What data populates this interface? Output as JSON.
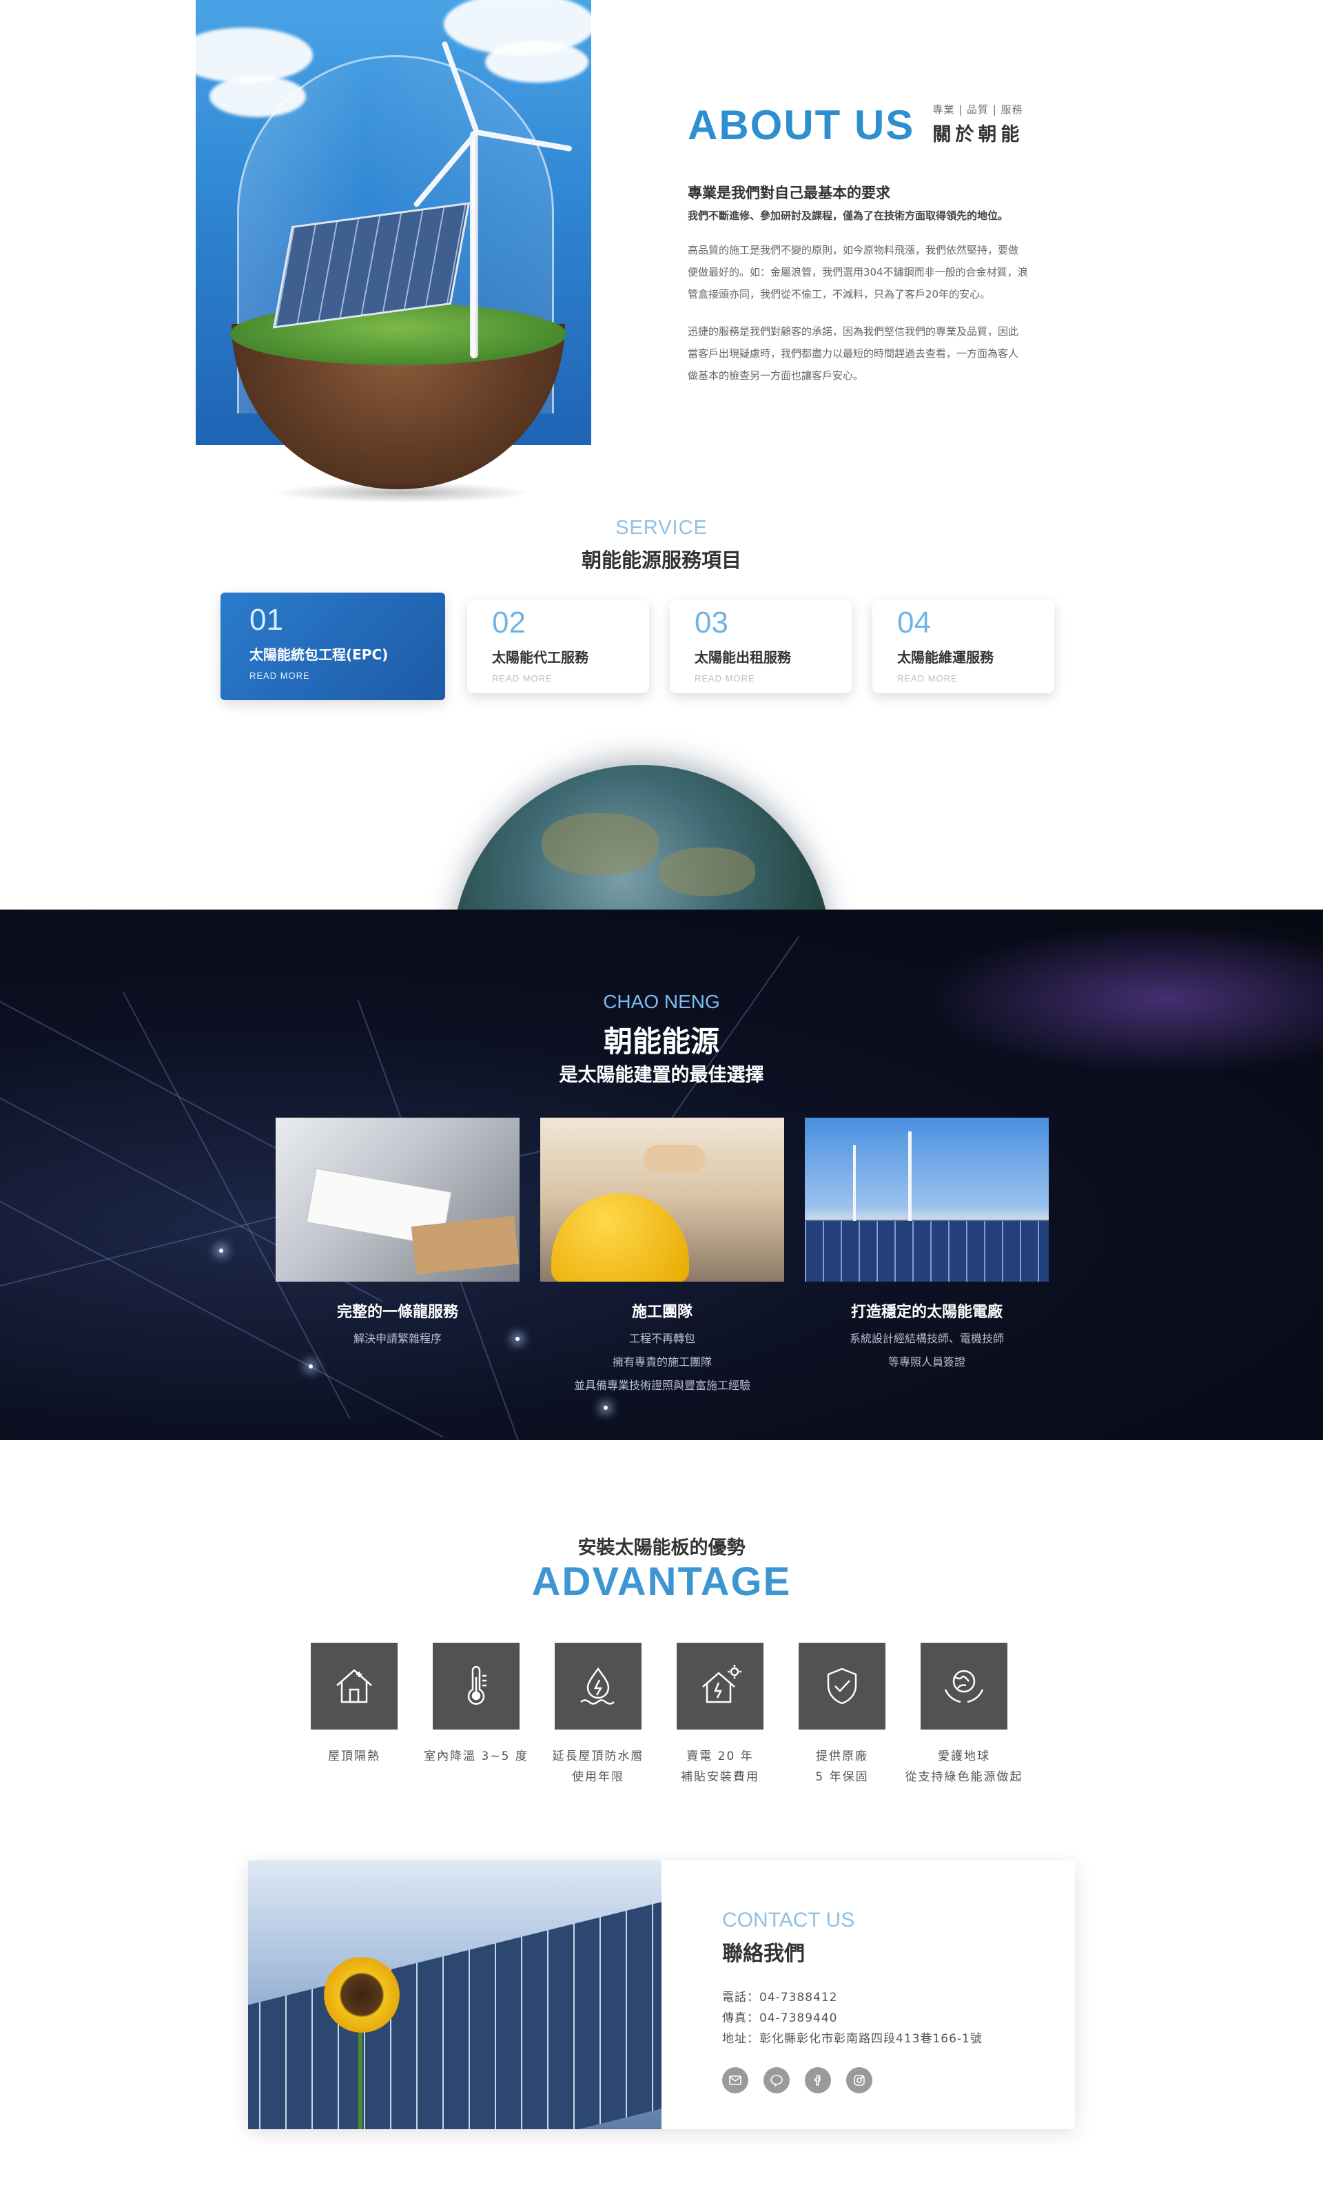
{
  "about": {
    "title_en": "ABOUT US",
    "tags": "專業 | 品質 | 服務",
    "title_zh": "關於朝能",
    "headline": "專業是我們對自己最基本的要求",
    "lead": "我們不斷進修、參加研討及課程，僅為了在技術方面取得領先的地位。",
    "paragraph1_line1": "高品質的施工是我們不變的原則，如今原物料飛漲，我們依然堅持，要做",
    "paragraph1_line2": "便做最好的。如：金屬浪管，我們選用304不鏽鋼而非一般的合金材質，浪",
    "paragraph1_line3": "管盒接頭亦同，我們從不偷工，不減料，只為了客戶20年的安心。",
    "paragraph2_line1": "迅捷的服務是我們對顧客的承諾，因為我們堅信我們的專業及品質，因此",
    "paragraph2_line2": "當客戶出現疑慮時，我們都盡力以最短的時間趕過去查看，一方面為客人",
    "paragraph2_line3": "做基本的檢查另一方面也讓客戶安心。"
  },
  "service": {
    "title_en": "SERVICE",
    "title_zh": "朝能能源服務項目",
    "cards": [
      {
        "num": "01",
        "title": "太陽能統包工程(EPC)",
        "more": "READ MORE"
      },
      {
        "num": "02",
        "title": "太陽能代工服務",
        "more": "READ MORE"
      },
      {
        "num": "03",
        "title": "太陽能出租服務",
        "more": "READ MORE"
      },
      {
        "num": "04",
        "title": "太陽能維運服務",
        "more": "READ MORE"
      }
    ]
  },
  "chaoneng": {
    "title_en": "CHAO NENG",
    "title_zh": "朝能能源",
    "subtitle": "是太陽能建置的最佳選擇",
    "features": [
      {
        "title": "完整的一條龍服務",
        "line1": "解決申請繁雜程序",
        "line2": "",
        "line3": ""
      },
      {
        "title": "施工團隊",
        "line1": "工程不再轉包",
        "line2": "擁有專責的施工團隊",
        "line3": "並具備專業技術證照與豐富施工經驗"
      },
      {
        "title": "打造穩定的太陽能電廠",
        "line1": "系統設計經結構技師、電機技師",
        "line2": "等專照人員簽證",
        "line3": ""
      }
    ]
  },
  "advantage": {
    "title_zh": "安裝太陽能板的優勢",
    "title_en": "ADVANTAGE",
    "items": [
      {
        "icon": "house-icon",
        "line1": "屋頂隔熱",
        "line2": ""
      },
      {
        "icon": "thermometer-icon",
        "line1": "室內降溫 3~5 度",
        "line2": ""
      },
      {
        "icon": "waterproof-icon",
        "line1": "延長屋頂防水層",
        "line2": "使用年限"
      },
      {
        "icon": "solar-house-icon",
        "line1": "賣電 20 年",
        "line2": "補貼安裝費用"
      },
      {
        "icon": "shield-check-icon",
        "line1": "提供原廠",
        "line2": "5 年保固"
      },
      {
        "icon": "globe-hands-icon",
        "line1": "愛護地球",
        "line2": "從支持綠色能源做起"
      }
    ]
  },
  "contact": {
    "title_en": "CONTACT US",
    "title_zh": "聯絡我們",
    "phone": "電話：04-7388412",
    "fax": "傳真：04-7389440",
    "address": "地址：彰化縣彰化市彰南路四段413巷166-1號",
    "social": [
      "mail-icon",
      "line-icon",
      "facebook-icon",
      "instagram-icon"
    ]
  },
  "colors": {
    "accent": "#2d8fd0",
    "accent_light": "#8ec0e6",
    "card_active": "#1d5aa6",
    "dark_bg": "#0c1022",
    "icon_bg": "#525252"
  }
}
